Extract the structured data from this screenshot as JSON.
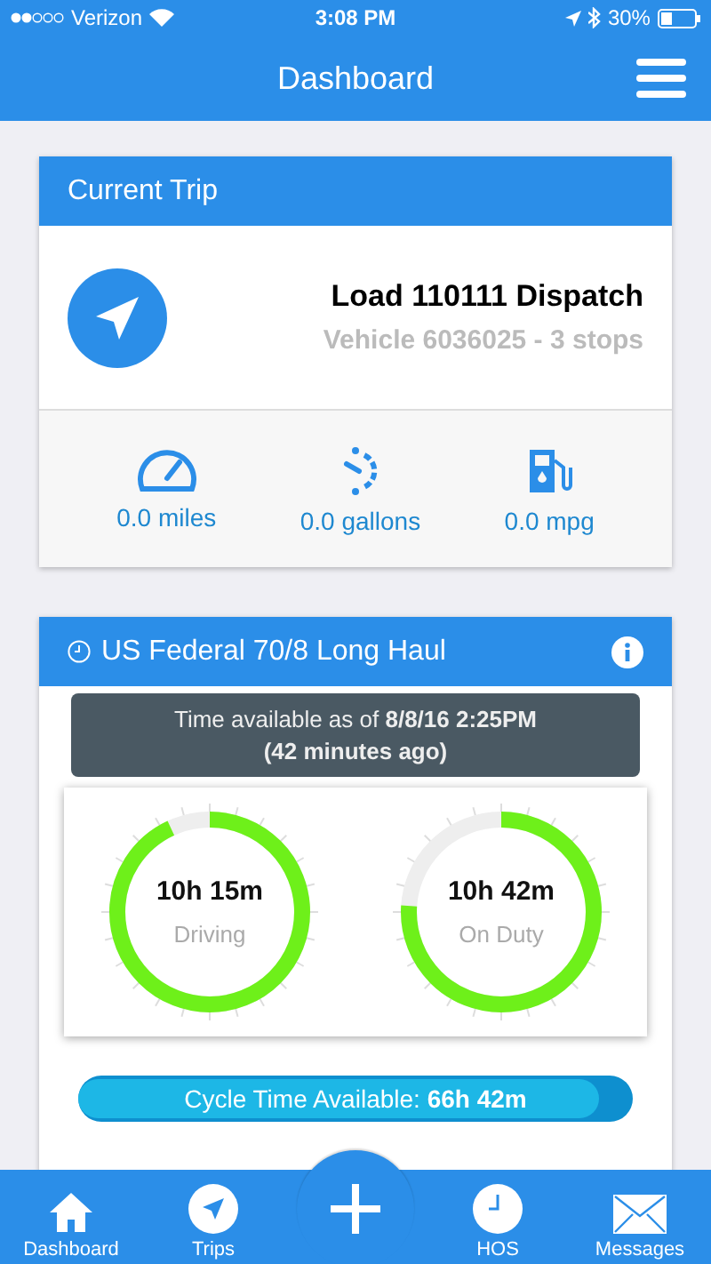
{
  "status_bar": {
    "carrier": "Verizon",
    "time": "3:08 PM",
    "battery": "30%"
  },
  "header": {
    "title": "Dashboard"
  },
  "current_trip": {
    "title": "Current Trip",
    "load": "Load 110111 Dispatch",
    "vehicle": "Vehicle 6036025 - 3 stops",
    "stats": [
      {
        "kind": "odometer",
        "value": "0.0 miles"
      },
      {
        "kind": "fuel-gauge",
        "value": "0.0 gallons"
      },
      {
        "kind": "pump",
        "value": "0.0 mpg"
      }
    ]
  },
  "hos": {
    "title": "US Federal 70/8 Long Haul",
    "available": "Time available as of **8/8/16 2:25PM**",
    "ago": "(42 minutes ago)",
    "clocks": [
      {
        "time": "10h 15m",
        "label": "Driving",
        "level": 0.93
      },
      {
        "time": "10h 42m",
        "label": "On Duty",
        "level": 0.76
      }
    ],
    "cycle": {
      "text": "Cycle Time Available: **66h 42m**",
      "level": 0.94
    }
  },
  "tabs": [
    {
      "kind": "home",
      "label": "Dashboard"
    },
    {
      "kind": "trips",
      "label": "Trips"
    },
    {
      "kind": "add"
    },
    {
      "kind": "clock",
      "label": "HOS"
    },
    {
      "kind": "mail",
      "label": "Messages"
    }
  ]
}
